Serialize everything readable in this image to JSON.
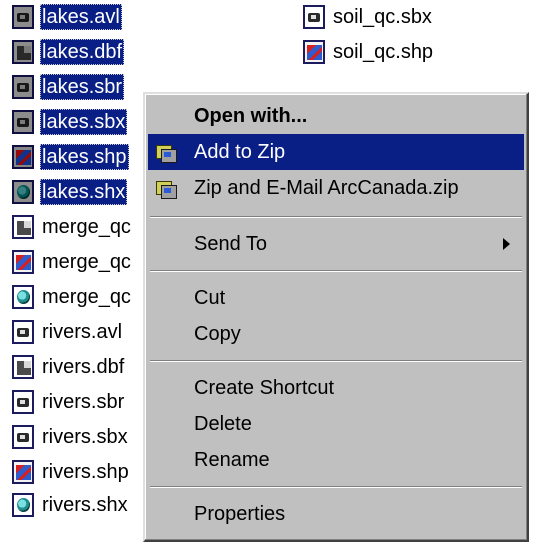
{
  "file_list": {
    "column1": [
      {
        "name": "lakes.avl",
        "icon": "avl-file-icon",
        "selected": true
      },
      {
        "name": "lakes.dbf",
        "icon": "dbf-file-icon",
        "selected": true
      },
      {
        "name": "lakes.sbr",
        "icon": "sbn-file-icon",
        "selected": true
      },
      {
        "name": "lakes.sbx",
        "icon": "sbx-file-icon",
        "selected": true
      },
      {
        "name": "lakes.shp",
        "icon": "shp-file-icon",
        "selected": true
      },
      {
        "name": "lakes.shx",
        "icon": "shx-file-icon",
        "selected": true
      },
      {
        "name": "merge_qc",
        "icon": "dbf-file-icon",
        "selected": false
      },
      {
        "name": "merge_qc",
        "icon": "shp-file-icon",
        "selected": false
      },
      {
        "name": "merge_qc",
        "icon": "shx-file-icon",
        "selected": false
      },
      {
        "name": "rivers.avl",
        "icon": "avl-file-icon",
        "selected": false
      },
      {
        "name": "rivers.dbf",
        "icon": "dbf-file-icon",
        "selected": false
      },
      {
        "name": "rivers.sbr",
        "icon": "sbn-file-icon",
        "selected": false
      },
      {
        "name": "rivers.sbx",
        "icon": "sbx-file-icon",
        "selected": false
      },
      {
        "name": "rivers.shp",
        "icon": "shp-file-icon",
        "selected": false
      },
      {
        "name": "rivers.shx",
        "icon": "shx-file-icon",
        "selected": false
      }
    ],
    "column2": [
      {
        "name": "soil_qc.sbx",
        "icon": "sbx-file-icon"
      },
      {
        "name": "soil_qc.shp",
        "icon": "shp-file-icon"
      }
    ]
  },
  "context_menu": {
    "open_with": "Open with...",
    "add_to_zip": "Add to Zip",
    "zip_and_email": "Zip and E-Mail ArcCanada.zip",
    "send_to": "Send To",
    "cut": "Cut",
    "copy": "Copy",
    "create_shortcut": "Create Shortcut",
    "delete": "Delete",
    "rename": "Rename",
    "properties": "Properties"
  },
  "colors": {
    "selection": "#0a1f85",
    "menu_background": "#c0c0c0"
  }
}
